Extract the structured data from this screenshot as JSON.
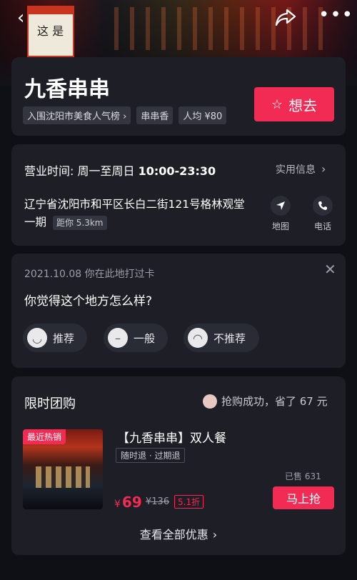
{
  "header": {
    "back_icon": "back-icon",
    "share_icon": "share-icon",
    "more_icon": "more-icon"
  },
  "hero_sign": {
    "text": "这 是"
  },
  "store": {
    "name": "九香串串",
    "tags": [
      "入围沈阳市美食人气榜 ›",
      "串串香",
      "人均 ¥80"
    ],
    "want_button": "想去"
  },
  "info": {
    "hours_label": "营业时间:",
    "hours_days": "周一至周日",
    "hours_time": "10:00-23:30",
    "info_link": "实用信息",
    "address": "辽宁省沈阳市和平区长白二街121号格林观堂一期",
    "distance": "距你 5.3km",
    "map_label": "地图",
    "phone_label": "电话"
  },
  "review": {
    "checkin": "2021.10.08 你在此地打过卡",
    "question": "你觉得这个地方怎么样?",
    "options": [
      "推荐",
      "一般",
      "不推荐"
    ]
  },
  "deals": {
    "title": "限时团购",
    "status": "抢购成功，省了 67 元",
    "hot_tag": "最近热销",
    "product_name": "【九香串串】双人餐",
    "refund_tag": "随时退 · 过期退",
    "sold": "已售 631",
    "currency": "¥",
    "price": "69",
    "original_price": "¥136",
    "discount": "5.1折",
    "buy_button": "马上抢",
    "view_all": "查看全部优惠"
  },
  "colors": {
    "accent": "#f12b54",
    "card": "#1d1e26",
    "background": "#0f1016"
  }
}
